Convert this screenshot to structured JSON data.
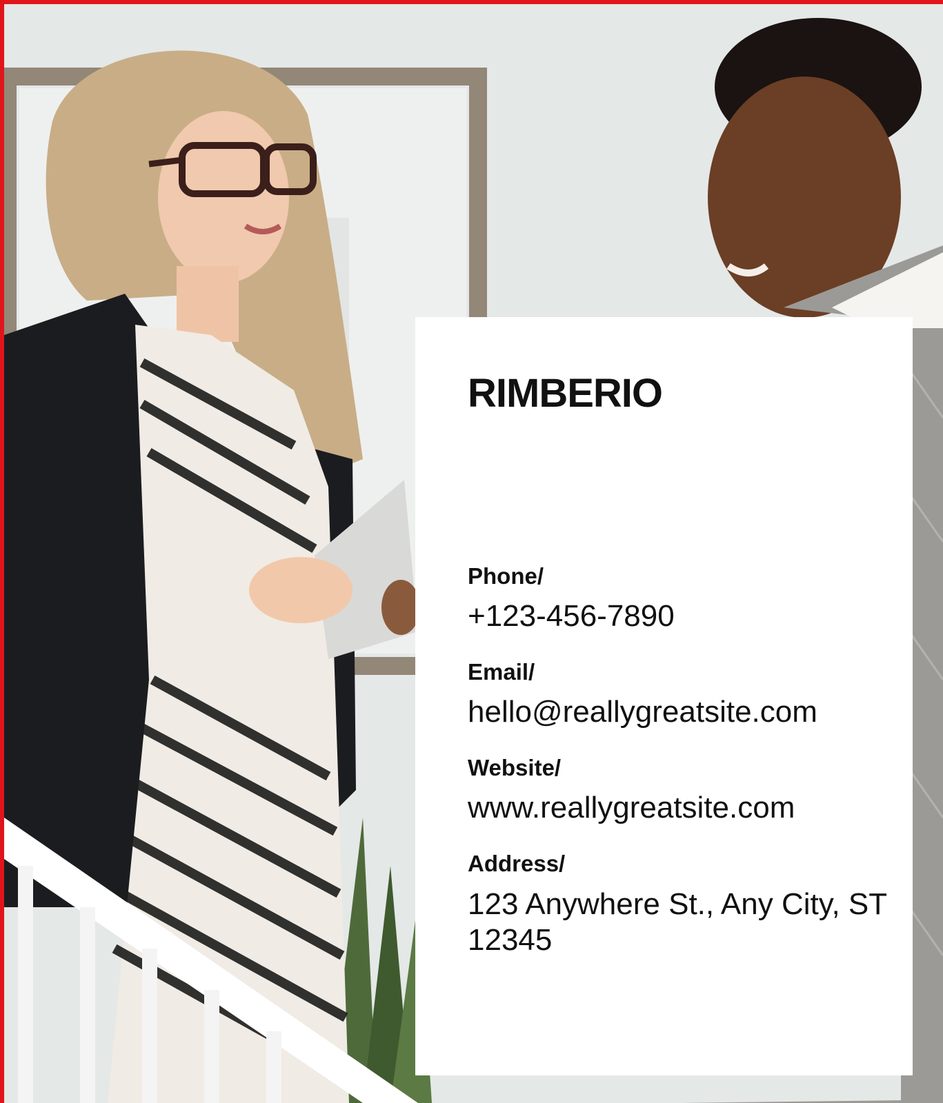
{
  "brand": "RIMBERIO",
  "contacts": [
    {
      "label": "Phone/",
      "value": "+123-456-7890"
    },
    {
      "label": "Email/",
      "value": "hello@reallygreatsite.com"
    },
    {
      "label": "Website/",
      "value": "www.reallygreatsite.com"
    },
    {
      "label": "Address/",
      "value": "123 Anywhere St., Any City, ST 12345"
    }
  ],
  "colors": {
    "accent_border": "#e0151b",
    "card_background": "#ffffff",
    "text": "#111111"
  }
}
